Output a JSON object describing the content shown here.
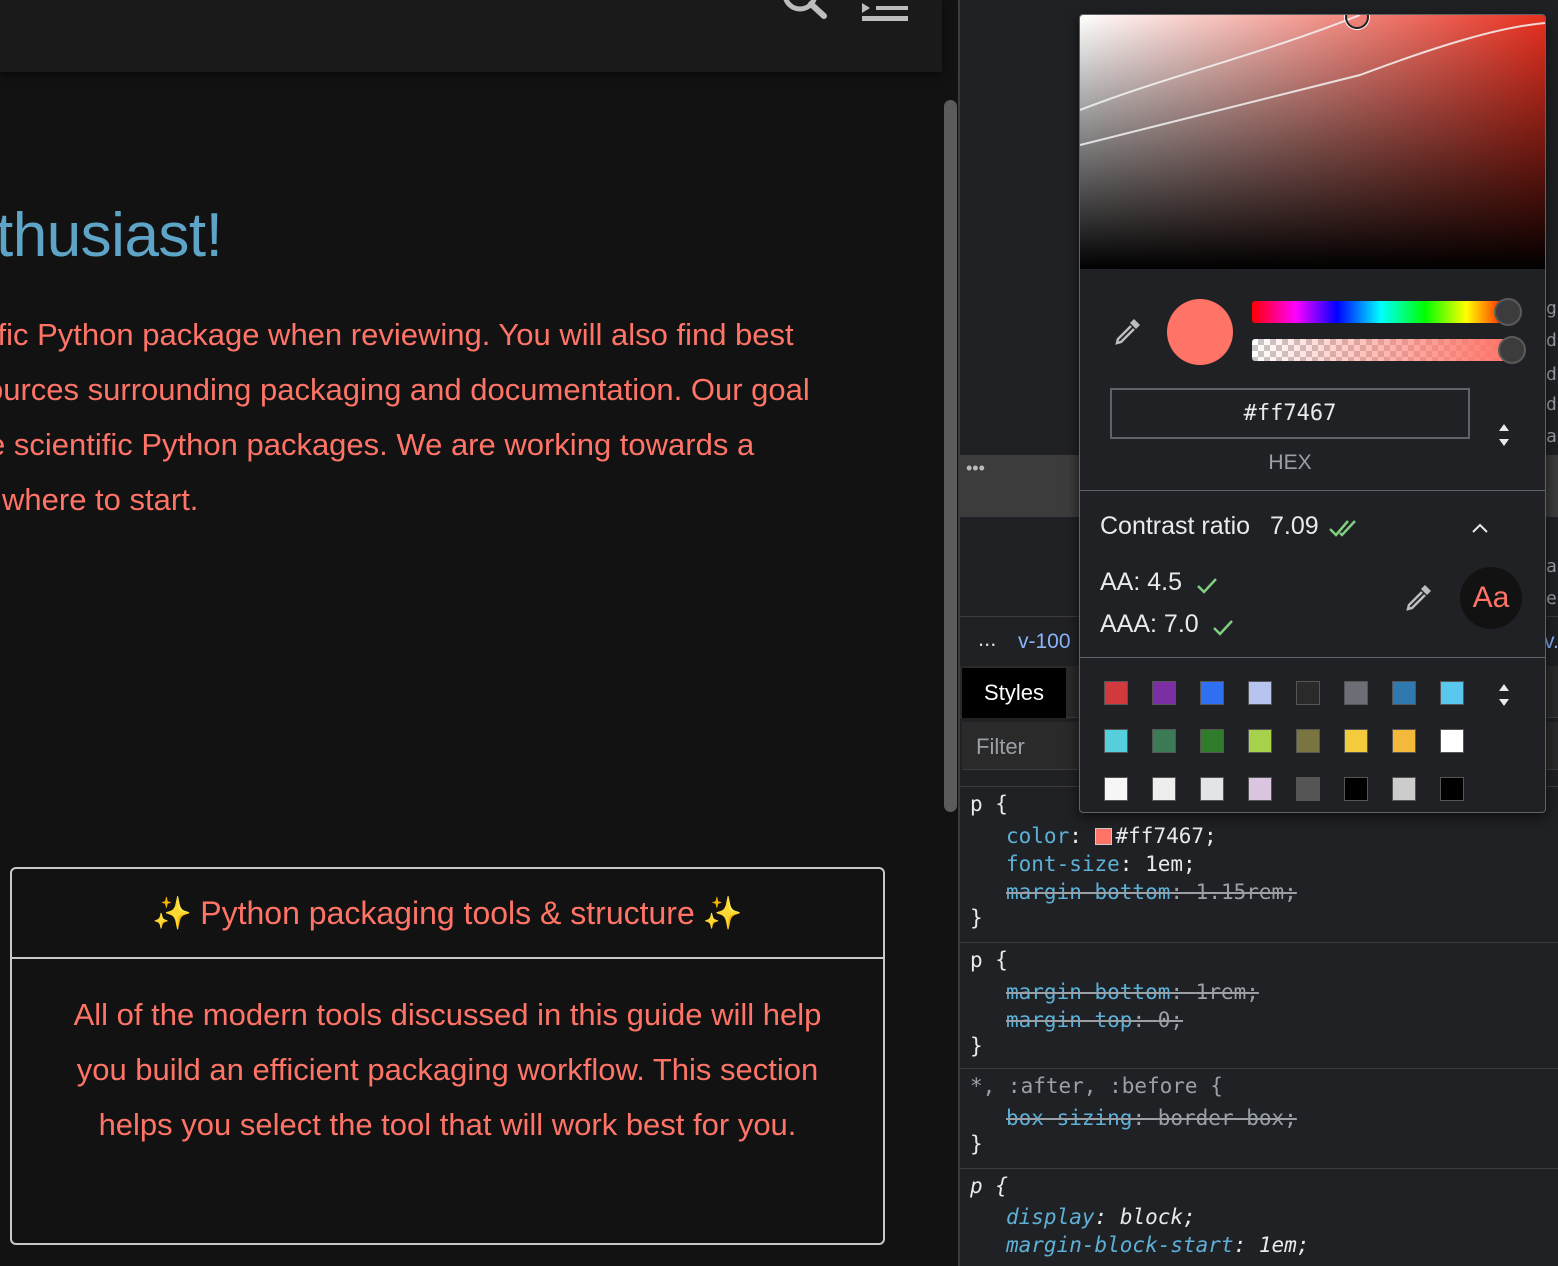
{
  "page": {
    "heading": "nthusiast!",
    "paragraph_lines": [
      "tific Python package when reviewing. You will also find best",
      "ources surrounding packaging and documentation. Our goal",
      "e scientific Python packages. We are working towards a",
      " where to start."
    ],
    "card": {
      "sparkle_left": "✨",
      "title": "Python packaging tools & structure",
      "sparkle_right": "✨",
      "body": "All of the modern tools discussed in this guide will help you build an efficient packaging workflow. This section helps you select the tool that will work best for you."
    },
    "text_color": "#ff7467",
    "heading_color": "#5ea4c6"
  },
  "devtools": {
    "breadcrumb_dots": "...",
    "breadcrumb_text": "v-100",
    "breadcrumb_end": "v.",
    "strip_dots": "•••",
    "tab_styles": "Styles",
    "filter_placeholder": "Filter",
    "rules": [
      {
        "selector": "p {",
        "lines": [
          {
            "prop": "color",
            "value": "#ff7467;",
            "swatch": true,
            "struck": false
          },
          {
            "prop": "font-size",
            "value": "1em;",
            "struck": false
          },
          {
            "prop": "margin-bottom",
            "value": "1.15rem;",
            "struck": true
          }
        ]
      },
      {
        "selector": "p {",
        "lines": [
          {
            "prop": "margin-bottom",
            "value": "1rem;",
            "struck": true
          },
          {
            "prop": "margin-top",
            "value": "0;",
            "struck": true
          }
        ]
      },
      {
        "selector": "*, :after, :before {",
        "lines": [
          {
            "prop": "box-sizing",
            "value": "border-box;",
            "struck": true
          }
        ]
      },
      {
        "selector": "p {",
        "lines": [
          {
            "prop": "display",
            "value": "block;",
            "struck": false
          },
          {
            "prop": "margin-block-start",
            "value": "1em;",
            "struck": false
          }
        ]
      }
    ],
    "close_brace": "}",
    "right_edge_chars": [
      "g",
      "d-",
      "d",
      "do",
      "ar",
      "ar",
      "et"
    ]
  },
  "color_picker": {
    "hex_value": "#ff7467",
    "format_label": "HEX",
    "contrast_label": "Contrast ratio",
    "contrast_value": "7.09",
    "aa_label": "AA: 4.5",
    "aaa_label": "AAA: 7.0",
    "preview_text": "Aa",
    "palette": [
      "#d1393f",
      "#7b2fa3",
      "#2f6ff2",
      "#b8c4f0",
      "#2a2a2a",
      "#6b6e75",
      "#2f79b0",
      "#5ac8ee",
      "#54cfdb",
      "#3a7a55",
      "#2f7c2a",
      "#a6d14a",
      "#7a7440",
      "#f3cb3c",
      "#f4b93a",
      "#ffffff",
      "#f7f7f7",
      "#eeeeee",
      "#e2e4e8",
      "#dac6e0",
      "#555555",
      "#000000",
      "#cccccc",
      "#000000"
    ],
    "accent_green": "#7fcf7f"
  }
}
